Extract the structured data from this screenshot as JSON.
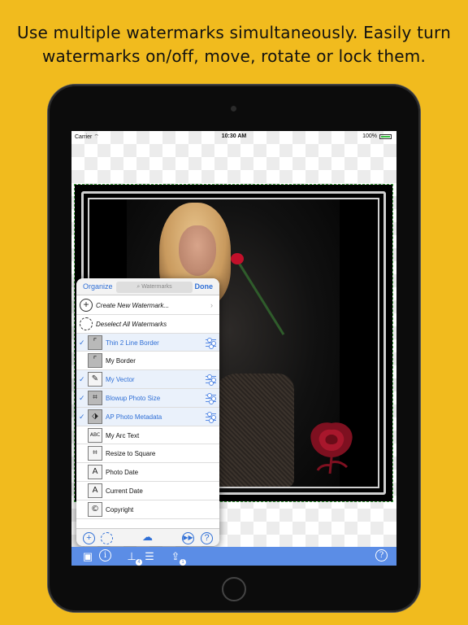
{
  "headline": "Use multiple watermarks simultaneously. Easily turn watermarks on/off, move, rotate or lock them.",
  "status_bar": {
    "carrier": "Carrier",
    "wifi_icon": "wifi-icon",
    "time": "10:30 AM",
    "battery": "100%"
  },
  "popover": {
    "organize_label": "Organize",
    "search_placeholder": "Watermarks",
    "done_label": "Done",
    "actions": [
      {
        "label": "Create New Watermark...",
        "icon": "plus-circle-icon"
      },
      {
        "label": "Deselect All Watermarks",
        "icon": "dashed-circle-icon"
      }
    ],
    "items": [
      {
        "label": "Thin 2 Line Border",
        "selected": true,
        "icon": "border-icon"
      },
      {
        "label": "My Border",
        "selected": false,
        "icon": "border-icon"
      },
      {
        "label": "My Vector",
        "selected": true,
        "icon": "vector-icon"
      },
      {
        "label": "Blowup Photo Size",
        "selected": true,
        "icon": "crop-icon"
      },
      {
        "label": "AP Photo Metadata",
        "selected": true,
        "icon": "tag-icon"
      },
      {
        "label": "My Arc Text",
        "selected": false,
        "icon": "arc-text-icon",
        "glyph": "ABC"
      },
      {
        "label": "Resize to Square",
        "selected": false,
        "icon": "crop-icon"
      },
      {
        "label": "Photo Date",
        "selected": false,
        "icon": "text-icon",
        "glyph": "A"
      },
      {
        "label": "Current Date",
        "selected": false,
        "icon": "text-icon",
        "glyph": "A"
      },
      {
        "label": "Copyright",
        "selected": false,
        "icon": "copyright-icon",
        "glyph": "©"
      }
    ],
    "footer_icons": [
      "add-icon",
      "deselect-icon",
      "cloud-icon",
      "play-icon",
      "help-icon"
    ]
  },
  "toolbar": {
    "icons": [
      "photo-icon",
      "info-icon",
      "watermark-stamp-icon",
      "adjust-icon",
      "share-icon",
      "help-icon"
    ],
    "stamp_badge": "4",
    "share_badge": "1"
  },
  "colors": {
    "background": "#f1bb1e",
    "accent": "#2f6fd6",
    "toolbar": "#5b8de6"
  }
}
